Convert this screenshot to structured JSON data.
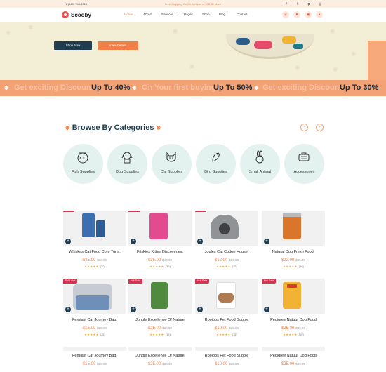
{
  "topbar": {
    "phone": "+1 (345) 754-3315",
    "shipping": "Free Shipping On Bil Ayritzan of $50 Or More",
    "social": [
      "facebook-icon",
      "twitter-icon",
      "pinterest-icon",
      "instagram-icon"
    ]
  },
  "header": {
    "logo": "Scooby",
    "nav": [
      "Home",
      "About",
      "Services",
      "Pages",
      "Shop",
      "Blog",
      "Contact"
    ],
    "nav_dropdown": [
      true,
      false,
      true,
      true,
      true,
      true,
      false
    ],
    "icons": [
      "search-icon",
      "heart-icon",
      "cart-icon",
      "user-icon"
    ]
  },
  "hero": {
    "shop_now": "Shop Now",
    "view_details": "View Details"
  },
  "marquee": {
    "items": [
      {
        "text": "Get exciting Discount",
        "style": "faint"
      },
      {
        "text": "Up To 40%",
        "style": "bold"
      },
      {
        "text": "On Your first buying",
        "style": "faint"
      },
      {
        "text": "Up To 50%",
        "style": "bold"
      },
      {
        "text": "Get exciting Discount",
        "style": "faint"
      },
      {
        "text": "Up To 30%",
        "style": "bold"
      }
    ]
  },
  "categories": {
    "title": "Browse By Categories",
    "items": [
      {
        "label": "Fish Supplies",
        "icon": "fish-bowl-icon"
      },
      {
        "label": "Dog Supplies",
        "icon": "dog-icon"
      },
      {
        "label": "Cat Supplies",
        "icon": "cat-icon"
      },
      {
        "label": "Bird Supplies",
        "icon": "bird-icon"
      },
      {
        "label": "Small Animal",
        "icon": "rabbit-icon"
      },
      {
        "label": "Accessories",
        "icon": "pet-carrier-icon"
      }
    ]
  },
  "products": [
    {
      "name": "Whiskas Cat Food Core Tuna.",
      "price": "$25.00",
      "old": "$30.00",
      "reviews": "(30)",
      "badge": ""
    },
    {
      "name": "Friskies Kitten Discoveries.",
      "price": "$35.00",
      "old": "$40.00",
      "reviews": "(30)",
      "badge": ""
    },
    {
      "name": "Joules Cat Cotton House.",
      "price": "$12.00",
      "old": "$20.00",
      "reviews": "(15)",
      "badge": ""
    },
    {
      "name": "Natural Dog Fresh Food.",
      "price": "$22.00",
      "old": "$25.00",
      "reviews": "(30)",
      "badge": ""
    },
    {
      "name": "Ferplast Cat Journey Bag.",
      "price": "$15.00",
      "old": "$20.00",
      "reviews": "(15)",
      "badge": "Sold Out"
    },
    {
      "name": "Jungle Excellence Of Nature",
      "price": "$25.00",
      "old": "$30.00",
      "reviews": "(15)",
      "badge": "Hot Sale"
    },
    {
      "name": "Rooibos Pet Food Supple",
      "price": "$10.00",
      "old": "$15.00",
      "reviews": "(15)",
      "badge": "Hot Sale"
    },
    {
      "name": "Pedigree Natuur Dog Food",
      "price": "$25.00",
      "old": "$30.00",
      "reviews": "(15)",
      "badge": "Hot Sale"
    },
    {
      "name": "Ferplast Cat Journey Bag.",
      "price": "$15.00",
      "old": "$20.00",
      "reviews": "",
      "badge": ""
    },
    {
      "name": "Jungle Excellence Of Nature",
      "price": "$25.00",
      "old": "$30.00",
      "reviews": "",
      "badge": ""
    },
    {
      "name": "Rooibos Pet Food Supple",
      "price": "$10.00",
      "old": "$15.00",
      "reviews": "",
      "badge": ""
    },
    {
      "name": "Pedigree Natuur Dog Food",
      "price": "$25.00",
      "old": "$30.00",
      "reviews": "",
      "badge": ""
    }
  ],
  "colors": {
    "accent": "#ef8148",
    "dark": "#1f3c4f",
    "sale": "#e0304e",
    "hero_bg": "#f3efd6",
    "category_bg": "#e3f2ef"
  }
}
